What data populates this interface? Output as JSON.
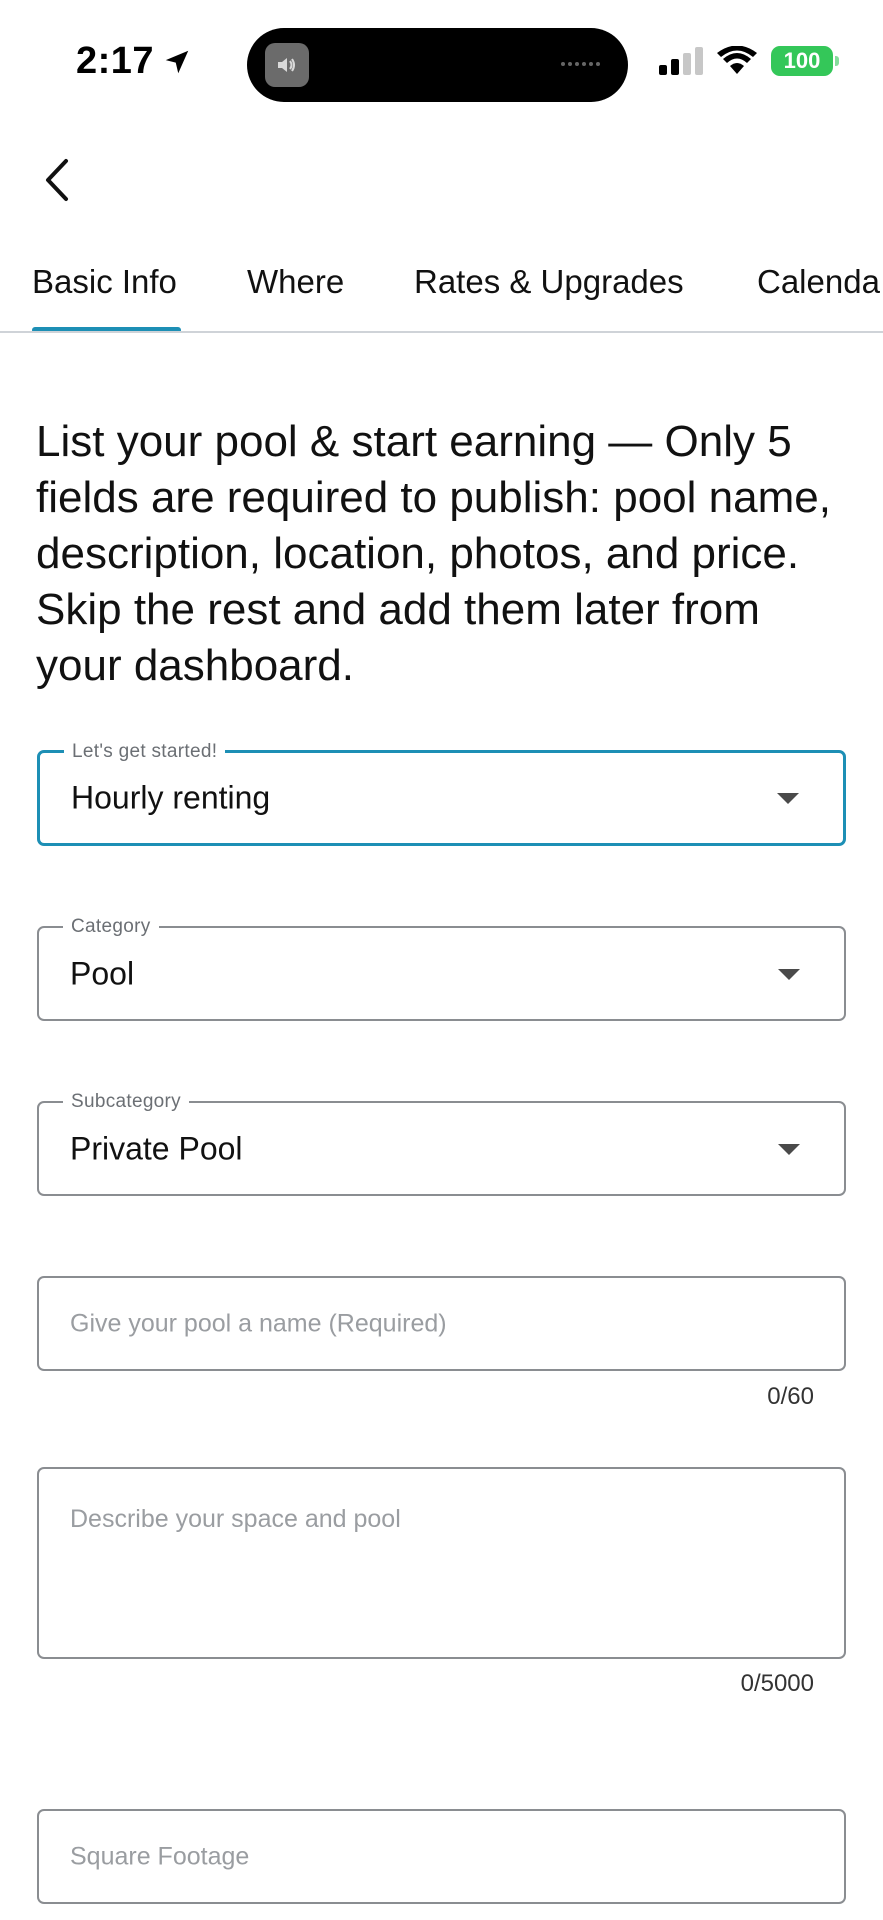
{
  "status_bar": {
    "time": "2:17",
    "battery": "100"
  },
  "navigation": {
    "back_icon": "chevron-left-icon"
  },
  "tabs": [
    {
      "label": "Basic Info",
      "active": true
    },
    {
      "label": "Where",
      "active": false
    },
    {
      "label": "Rates & Upgrades",
      "active": false
    },
    {
      "label": "Calenda",
      "active": false
    }
  ],
  "intro_text": "List your pool & start earning — Only 5 fields are required to publish: pool name, description, location, photos, and price. Skip the rest and add them later from your dashboard.",
  "form": {
    "listing_type": {
      "label": "Let's get started!",
      "value": "Hourly renting"
    },
    "category": {
      "label": "Category",
      "value": "Pool"
    },
    "subcategory": {
      "label": "Subcategory",
      "value": "Private Pool"
    },
    "pool_name": {
      "placeholder": "Give your pool a name (Required)",
      "counter": "0/60"
    },
    "description": {
      "placeholder": "Describe your space and pool",
      "counter": "0/5000"
    },
    "square_footage": {
      "placeholder": "Square Footage"
    }
  },
  "colors": {
    "accent": "#1d8fb5",
    "battery": "#34c759"
  }
}
